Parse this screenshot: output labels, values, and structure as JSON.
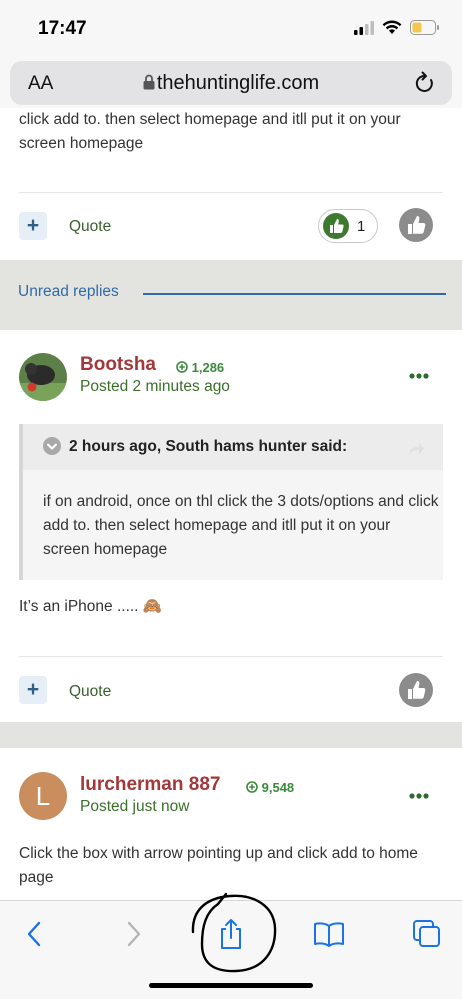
{
  "status_bar": {
    "time": "17:47"
  },
  "url_bar": {
    "aa_label": "AA",
    "domain": "thehuntinglife.com"
  },
  "previous_post": {
    "text": "click add to. then select homepage and itll put it on your screen homepage",
    "quote_label": "Quote",
    "like_count": "1"
  },
  "unread": {
    "label": "Unread replies"
  },
  "post1": {
    "author": "Bootsha",
    "reputation": "1,286",
    "posted": "Posted 2 minutes ago",
    "quote_header": "2 hours ago, South hams hunter said:",
    "quote_body": "if on android, once on thl click the 3 dots/options and click add to. then select homepage and itll put it on your screen homepage",
    "body": "It’s an iPhone ..... 🙈",
    "quote_label": "Quote"
  },
  "post2": {
    "author": "lurcherman 887",
    "avatar_letter": "L",
    "reputation": "9,548",
    "posted": "Posted just now",
    "body": "Click the box with arrow pointing up and click add to home page"
  },
  "toolbar": {
    "back": "back-icon",
    "forward": "forward-icon",
    "share": "share-icon",
    "bookmarks": "bookmarks-icon",
    "tabs": "tabs-icon"
  },
  "colors": {
    "author": "#a33838",
    "posted": "#3b6f2a",
    "accent_blue": "#2e6ba8",
    "ios_blue": "#1a73e8"
  }
}
